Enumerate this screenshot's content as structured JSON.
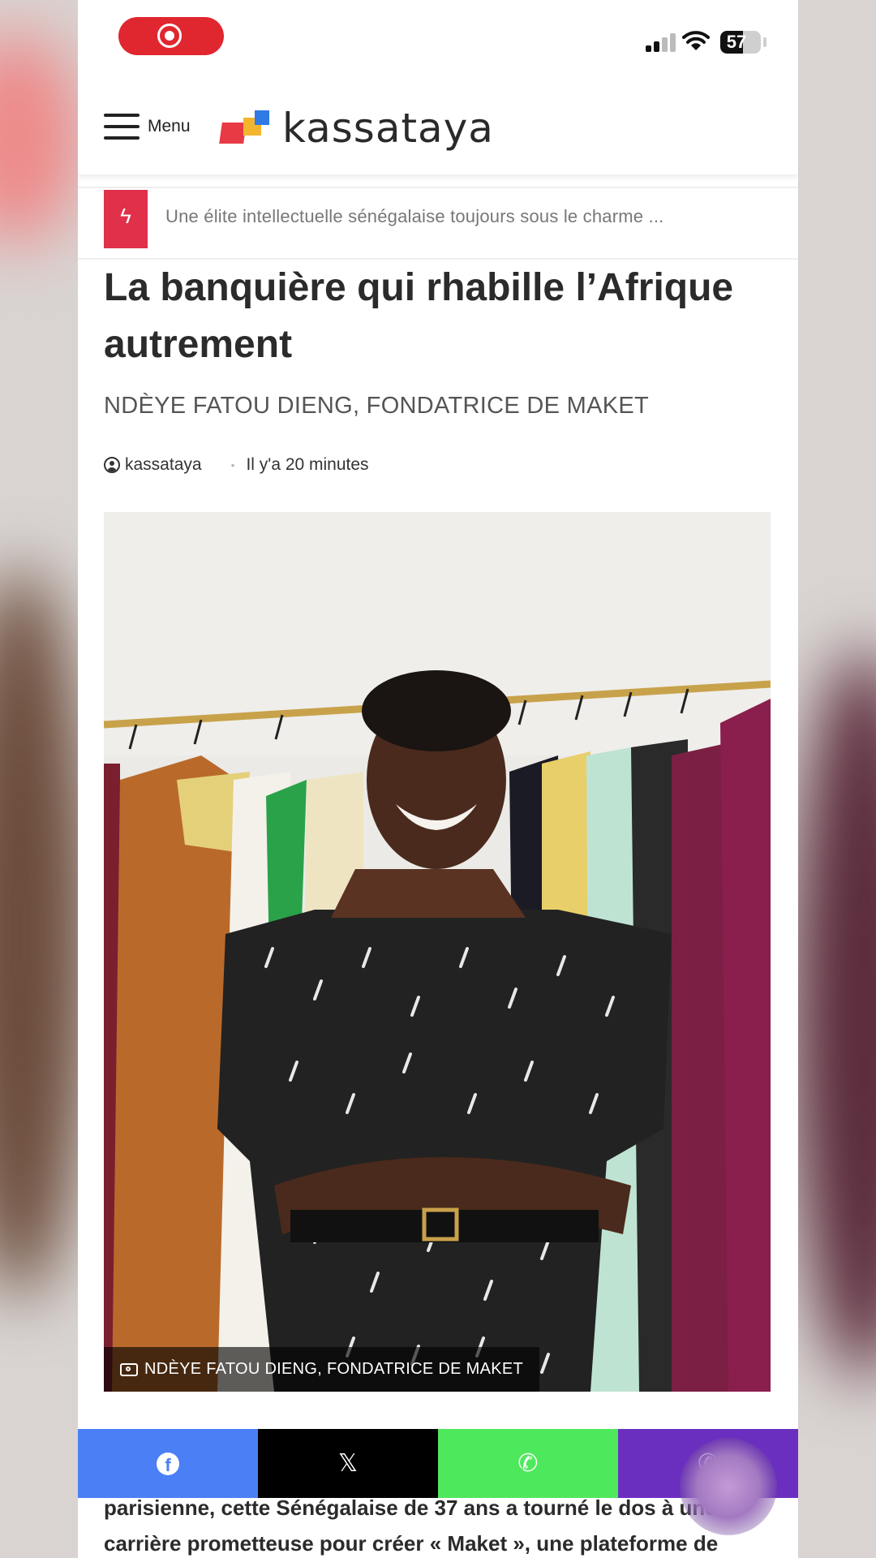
{
  "status": {
    "battery": "57"
  },
  "header": {
    "menu_label": "Menu",
    "logo_text": "kassataya"
  },
  "ticker": {
    "text": "Une élite intellectuelle sénégalaise toujours sous le charme ..."
  },
  "article": {
    "title": "La banquière qui rhabille l’Afrique autrement",
    "subtitle": "NDÈYE FATOU DIENG, FONDATRICE DE MAKET",
    "author": "kassataya",
    "time": "Il y'a 20 minutes",
    "photo_caption": "NDÈYE FATOU DIENG, FONDATRICE DE MAKET",
    "body": "parisienne, cette Sénégalaise de 37 ans a tourné le dos à une carrière prometteuse pour créer « Maket », une plateforme de"
  },
  "share": {
    "facebook_glyph": "f",
    "x_glyph": "𝕏",
    "whatsapp_glyph": "✆",
    "phone_glyph": "✆"
  },
  "colors": {
    "accent": "#e0304a",
    "record": "#e0262f",
    "facebook": "#4a7ff5",
    "x": "#000000",
    "whatsapp": "#4ee85c",
    "phone": "#6b2fc0"
  }
}
